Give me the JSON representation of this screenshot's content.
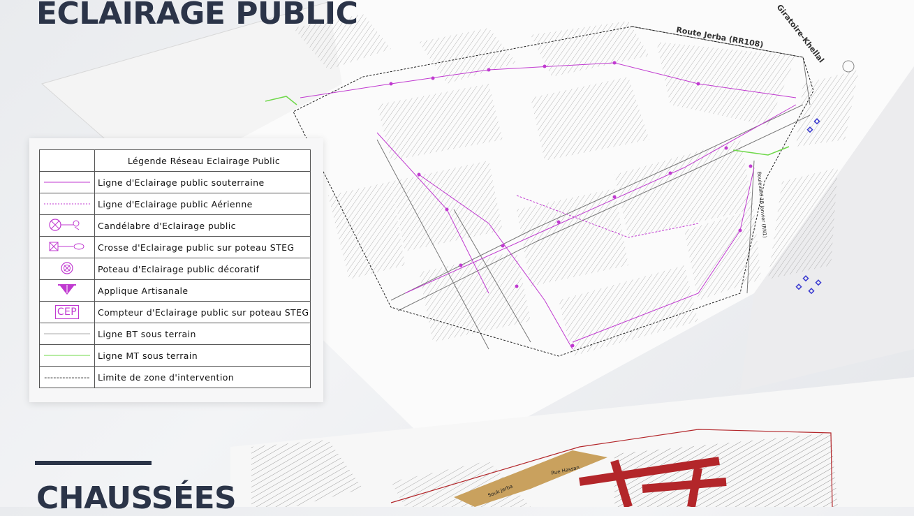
{
  "heading_top": "ECLAIRAGE PUBLIC",
  "heading_bottom": "CHAUSSÉES",
  "map": {
    "route_label": "Route Jerba (RR108)",
    "giratoire_label": "Giratoire-Khellal",
    "boulevard_label": "Boulevard 18 Janvier (RN1)",
    "lower_map_labels": [
      "Souk Jerba",
      "Rue Hassan"
    ]
  },
  "legend": {
    "title": "Légende Réseau Eclairage Public",
    "items": [
      {
        "symbol": "magenta-solid-line",
        "label": "Ligne d'Eclairage public souterraine"
      },
      {
        "symbol": "magenta-dashed-line",
        "label": "Ligne d'Eclairage public Aérienne"
      },
      {
        "symbol": "candelabre-icon",
        "label": "Candélabre d'Eclairage public"
      },
      {
        "symbol": "crosse-icon",
        "label": "Crosse d'Eclairage public sur poteau STEG"
      },
      {
        "symbol": "poteau-decoratif-icon",
        "label": "Poteau d'Eclairage public décoratif"
      },
      {
        "symbol": "applique-icon",
        "label": "Applique Artisanale"
      },
      {
        "symbol": "cep-box",
        "label": "Compteur d'Eclairage public sur poteau STEG",
        "text": "CEP"
      },
      {
        "symbol": "grey-line",
        "label": "Ligne BT sous terrain"
      },
      {
        "symbol": "green-line",
        "label": "Ligne MT sous terrain"
      },
      {
        "symbol": "black-dashed-line",
        "label": "Limite de zone d'intervention",
        "text": "---------------"
      }
    ]
  },
  "colors": {
    "heading": "#2b3448",
    "lighting": "#c03ad0",
    "mt_line": "#6fd84a",
    "road_red": "#b3262a",
    "road_tan": "#c9a15e"
  }
}
